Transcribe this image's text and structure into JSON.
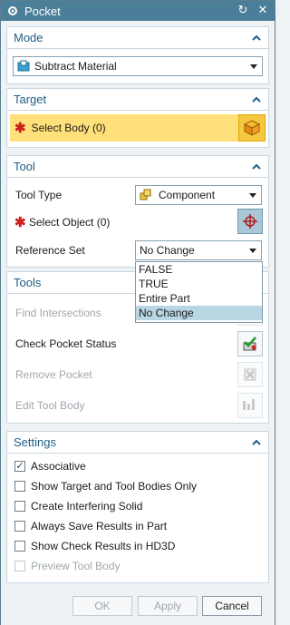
{
  "window": {
    "title": "Pocket"
  },
  "mode": {
    "heading": "Mode",
    "selected": "Subtract Material"
  },
  "target": {
    "heading": "Target",
    "select_body": "Select Body (0)"
  },
  "tool": {
    "heading": "Tool",
    "tool_type_label": "Tool Type",
    "tool_type_value": "Component",
    "select_object": "Select Object (0)",
    "reference_set_label": "Reference Set",
    "reference_set_value": "No Change",
    "reference_set_options": [
      "FALSE",
      "TRUE",
      "Entire Part",
      "No Change"
    ]
  },
  "tools": {
    "heading": "Tools",
    "find_intersections": "Find Intersections",
    "check_pocket_status": "Check Pocket Status",
    "remove_pocket": "Remove Pocket",
    "edit_tool_body": "Edit Tool Body"
  },
  "settings": {
    "heading": "Settings",
    "options": [
      {
        "label": "Associative",
        "checked": true,
        "enabled": true
      },
      {
        "label": "Show Target and Tool Bodies Only",
        "checked": false,
        "enabled": true
      },
      {
        "label": "Create Interfering Solid",
        "checked": false,
        "enabled": true
      },
      {
        "label": "Always Save Results in Part",
        "checked": false,
        "enabled": true
      },
      {
        "label": "Show Check Results in HD3D",
        "checked": false,
        "enabled": true
      },
      {
        "label": "Preview Tool Body",
        "checked": false,
        "enabled": false
      }
    ]
  },
  "buttons": {
    "ok": "OK",
    "apply": "Apply",
    "cancel": "Cancel"
  }
}
